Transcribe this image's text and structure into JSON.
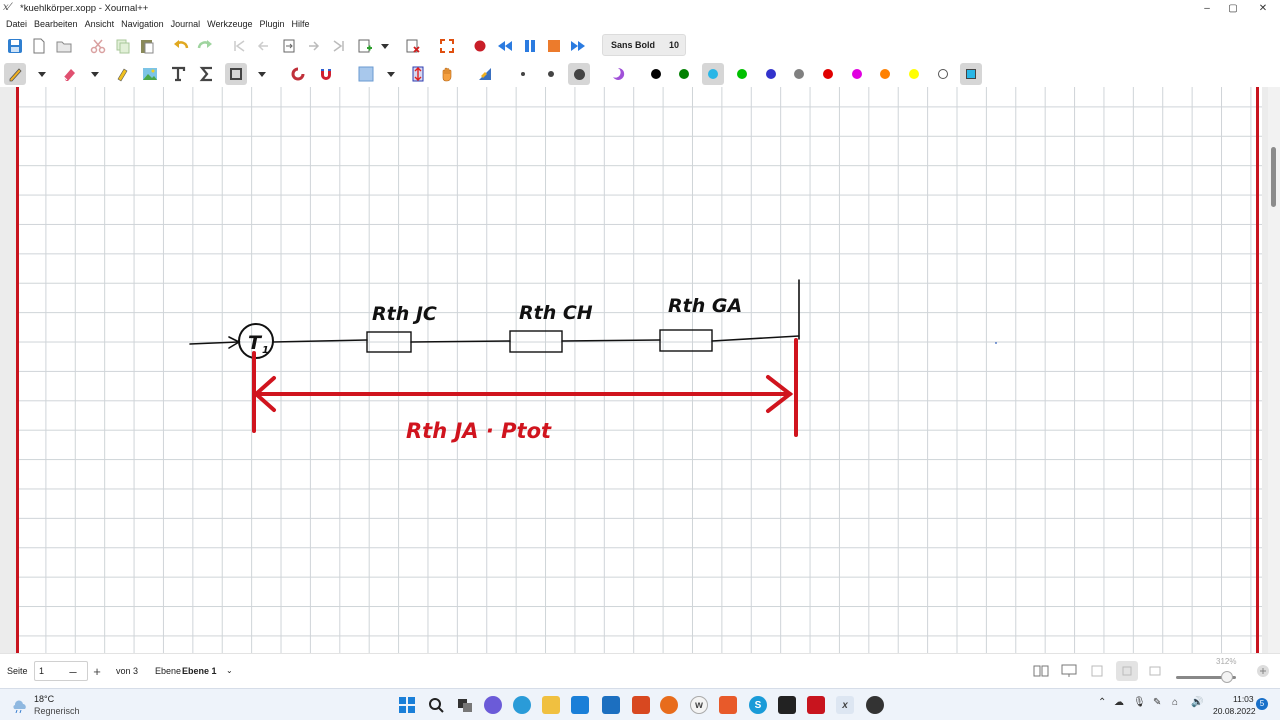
{
  "window": {
    "title": "*kuehlkörper.xopp - Xournal++",
    "controls": {
      "minimize": "–",
      "maximize": "▢",
      "close": "✕"
    }
  },
  "menu": [
    "Datei",
    "Bearbeiten",
    "Ansicht",
    "Navigation",
    "Journal",
    "Werkzeuge",
    "Plugin",
    "Hilfe"
  ],
  "toolbar": {
    "font_name": "Sans Bold",
    "font_size": "10",
    "active_color": "#29b6e6",
    "palette": [
      "#000000",
      "#008000",
      "#29b6e6",
      "#00c000",
      "#3333cc",
      "#808080",
      "#e00000",
      "#e000e0",
      "#ff8000",
      "#ffff00",
      "#ffffff"
    ]
  },
  "drawing": {
    "ink_color": "#111111",
    "accent_color": "#d0141e",
    "node_label": "T",
    "node_sub": "1",
    "resistors": [
      {
        "label": "Rth JC"
      },
      {
        "label": "Rth CH"
      },
      {
        "label": "Rth GA"
      }
    ],
    "red_annotation": "Rth JA · Ptot"
  },
  "status": {
    "page_label": "Seite",
    "page_value": "1",
    "minus": "–",
    "plus": "+",
    "page_of": "von 3",
    "layer_label": "Ebene",
    "layer_value": "Ebene 1",
    "zoom": "312%"
  },
  "taskbar": {
    "weather_temp": "18°C",
    "weather_text": "Regnerisch",
    "time": "11:03",
    "date": "20.08.2022",
    "notification_count": "5"
  }
}
